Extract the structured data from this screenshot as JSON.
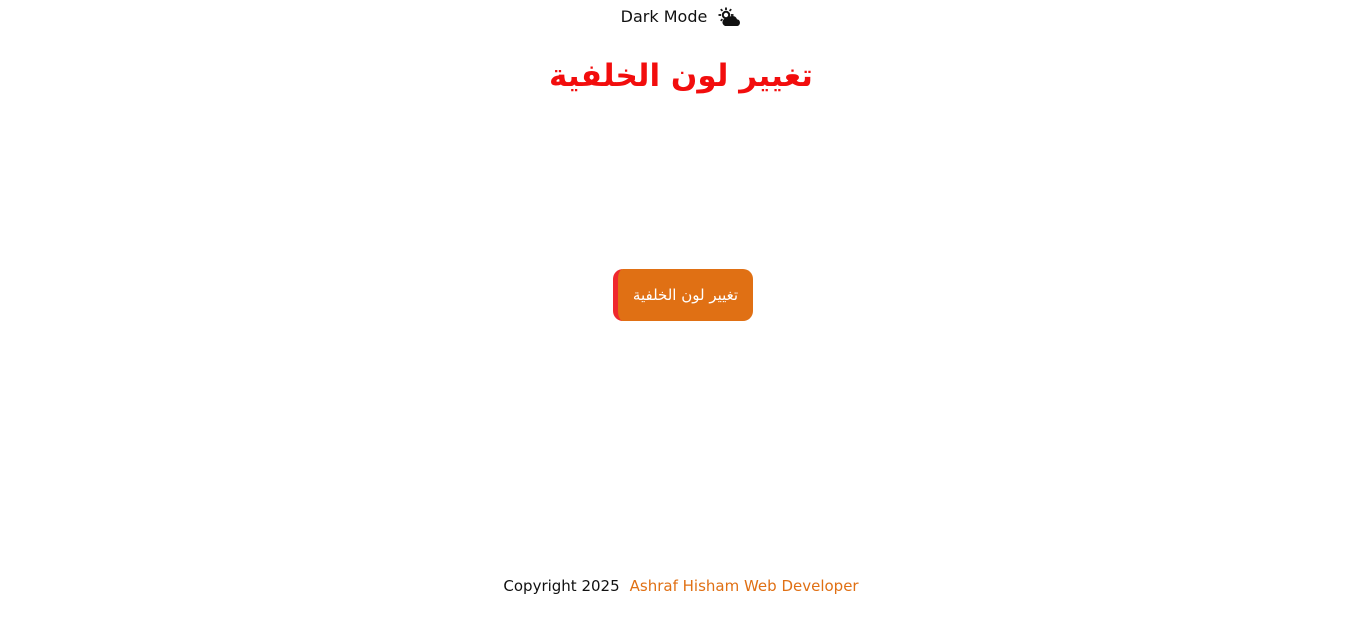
{
  "dark_mode": {
    "label": "Dark Mode",
    "icon": "cloud-sun-icon"
  },
  "title": {
    "text": "تغيير لون الخلفية",
    "color": "#f20d0d"
  },
  "button": {
    "label": "تغيير لون الخلفية",
    "background": "#e07014",
    "accent": "#f0282d"
  },
  "footer": {
    "copyright": "Copyright 2025",
    "author": "Ashraf Hisham Web Developer",
    "author_color": "#e07014"
  }
}
